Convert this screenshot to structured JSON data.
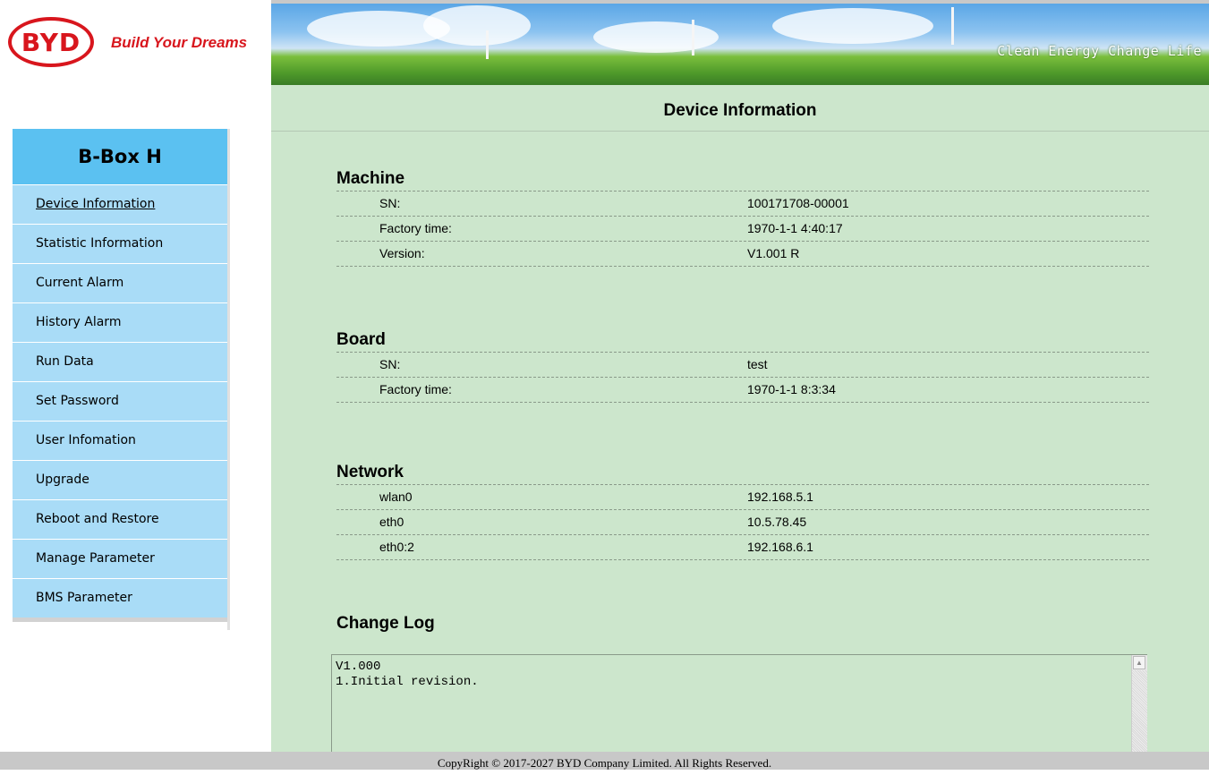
{
  "header": {
    "logo_text": "BYD",
    "tagline": "Build Your Dreams",
    "slogan": "Clean Energy Change Life"
  },
  "sidebar": {
    "product": "B-Box H",
    "items": [
      {
        "label": "Device Information"
      },
      {
        "label": "Statistic Information"
      },
      {
        "label": "Current Alarm"
      },
      {
        "label": "History Alarm"
      },
      {
        "label": "Run Data"
      },
      {
        "label": "Set Password"
      },
      {
        "label": "User Infomation"
      },
      {
        "label": "Upgrade"
      },
      {
        "label": "Reboot and Restore"
      },
      {
        "label": "Manage Parameter"
      },
      {
        "label": "BMS Parameter"
      }
    ]
  },
  "main": {
    "title": "Device Information",
    "machine": {
      "heading": "Machine",
      "rows": [
        {
          "label": "SN:",
          "value": "100171708-00001"
        },
        {
          "label": "Factory time:",
          "value": "1970-1-1 4:40:17"
        },
        {
          "label": "Version:",
          "value": "V1.001 R"
        }
      ]
    },
    "board": {
      "heading": "Board",
      "rows": [
        {
          "label": "SN:",
          "value": "test"
        },
        {
          "label": "Factory time:",
          "value": "1970-1-1 8:3:34"
        }
      ]
    },
    "network": {
      "heading": "Network",
      "rows": [
        {
          "label": "wlan0",
          "value": "192.168.5.1"
        },
        {
          "label": "eth0",
          "value": "10.5.78.45"
        },
        {
          "label": "eth0:2",
          "value": "192.168.6.1"
        }
      ]
    },
    "changelog": {
      "heading": "Change Log",
      "text": "V1.000\n1.Initial revision."
    }
  },
  "footer": {
    "copyright": "CopyRight © 2017-2027 BYD Company Limited. All Rights Reserved."
  }
}
